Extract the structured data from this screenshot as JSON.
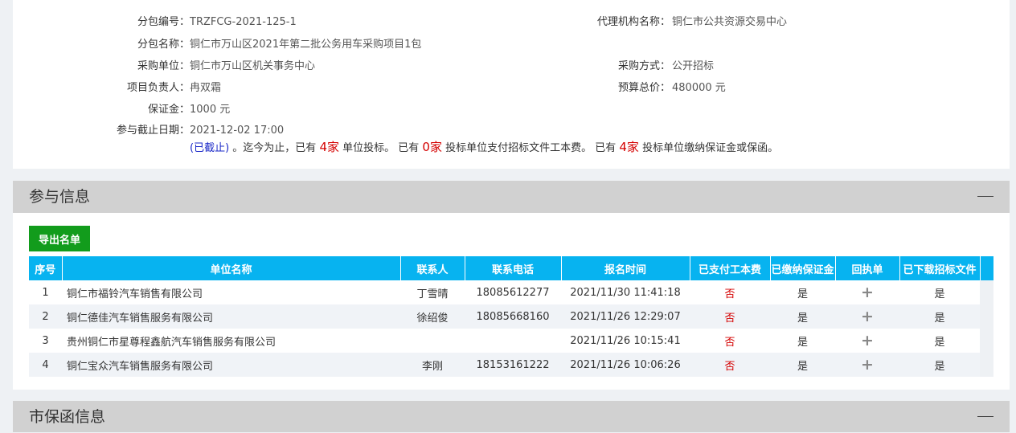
{
  "info": {
    "package_no_label": "分包编号：",
    "package_no": "TRZFCG-2021-125-1",
    "package_name_label": "分包名称：",
    "package_name": "铜仁市万山区2021年第二批公务用车采购项目1包",
    "purchaser_label": "采购单位：",
    "purchaser": "铜仁市万山区机关事务中心",
    "leader_label": "项目负责人：",
    "leader": "冉双霜",
    "deposit_label": "保证金：",
    "deposit": "1000 元",
    "deadline_label": "参与截止日期：",
    "deadline": "2021-12-02 17:00",
    "closed_tag": "(已截止)",
    "summary_1": "。迄今为止，已有",
    "count_bid": "4家",
    "summary_2": "单位投标。 已有",
    "count_paid": "0家",
    "summary_3": "投标单位支付招标文件工本费。 已有",
    "count_deposit": "4家",
    "summary_4": "投标单位缴纳保证金或保函。",
    "agency_label": "代理机构名称：",
    "agency": "铜仁市公共资源交易中心",
    "method_label": "采购方式：",
    "method": "公开招标",
    "budget_label": "预算总价：",
    "budget": "480000 元"
  },
  "participation": {
    "title": "参与信息",
    "export_label": "导出名单",
    "columns": [
      "序号",
      "单位名称",
      "联系人",
      "联系电话",
      "报名时间",
      "已支付工本费",
      "已缴纳保证金",
      "回执单",
      "已下载招标文件"
    ],
    "rows": [
      {
        "idx": "1",
        "name": "铜仁市福铃汽车销售有限公司",
        "contact": "丁雪晴",
        "phone": "18085612277",
        "time": "2021/11/30 11:41:18",
        "paid": "否",
        "deposit": "是",
        "receipt": "+",
        "downloaded": "是"
      },
      {
        "idx": "2",
        "name": "铜仁德佳汽车销售服务有限公司",
        "contact": "徐绍俊",
        "phone": "18085668160",
        "time": "2021/11/26 12:29:07",
        "paid": "否",
        "deposit": "是",
        "receipt": "+",
        "downloaded": "是"
      },
      {
        "idx": "3",
        "name": "贵州铜仁市星尊程鑫航汽车销售服务有限公司",
        "contact": "",
        "phone": "",
        "time": "2021/11/26 10:15:41",
        "paid": "否",
        "deposit": "是",
        "receipt": "+",
        "downloaded": "是"
      },
      {
        "idx": "4",
        "name": "铜仁宝众汽车销售服务有限公司",
        "contact": "李刚",
        "phone": "18153161222",
        "time": "2021/11/26 10:06:26",
        "paid": "否",
        "deposit": "是",
        "receipt": "+",
        "downloaded": "是"
      }
    ]
  },
  "guarantee": {
    "title": "市保函信息"
  },
  "colors": {
    "header_blue": "#07b3f0",
    "export_green": "#129c1c",
    "no_red": "#d40000"
  },
  "icons": {
    "collapse": "minus-icon",
    "receipt": "plus-icon"
  }
}
